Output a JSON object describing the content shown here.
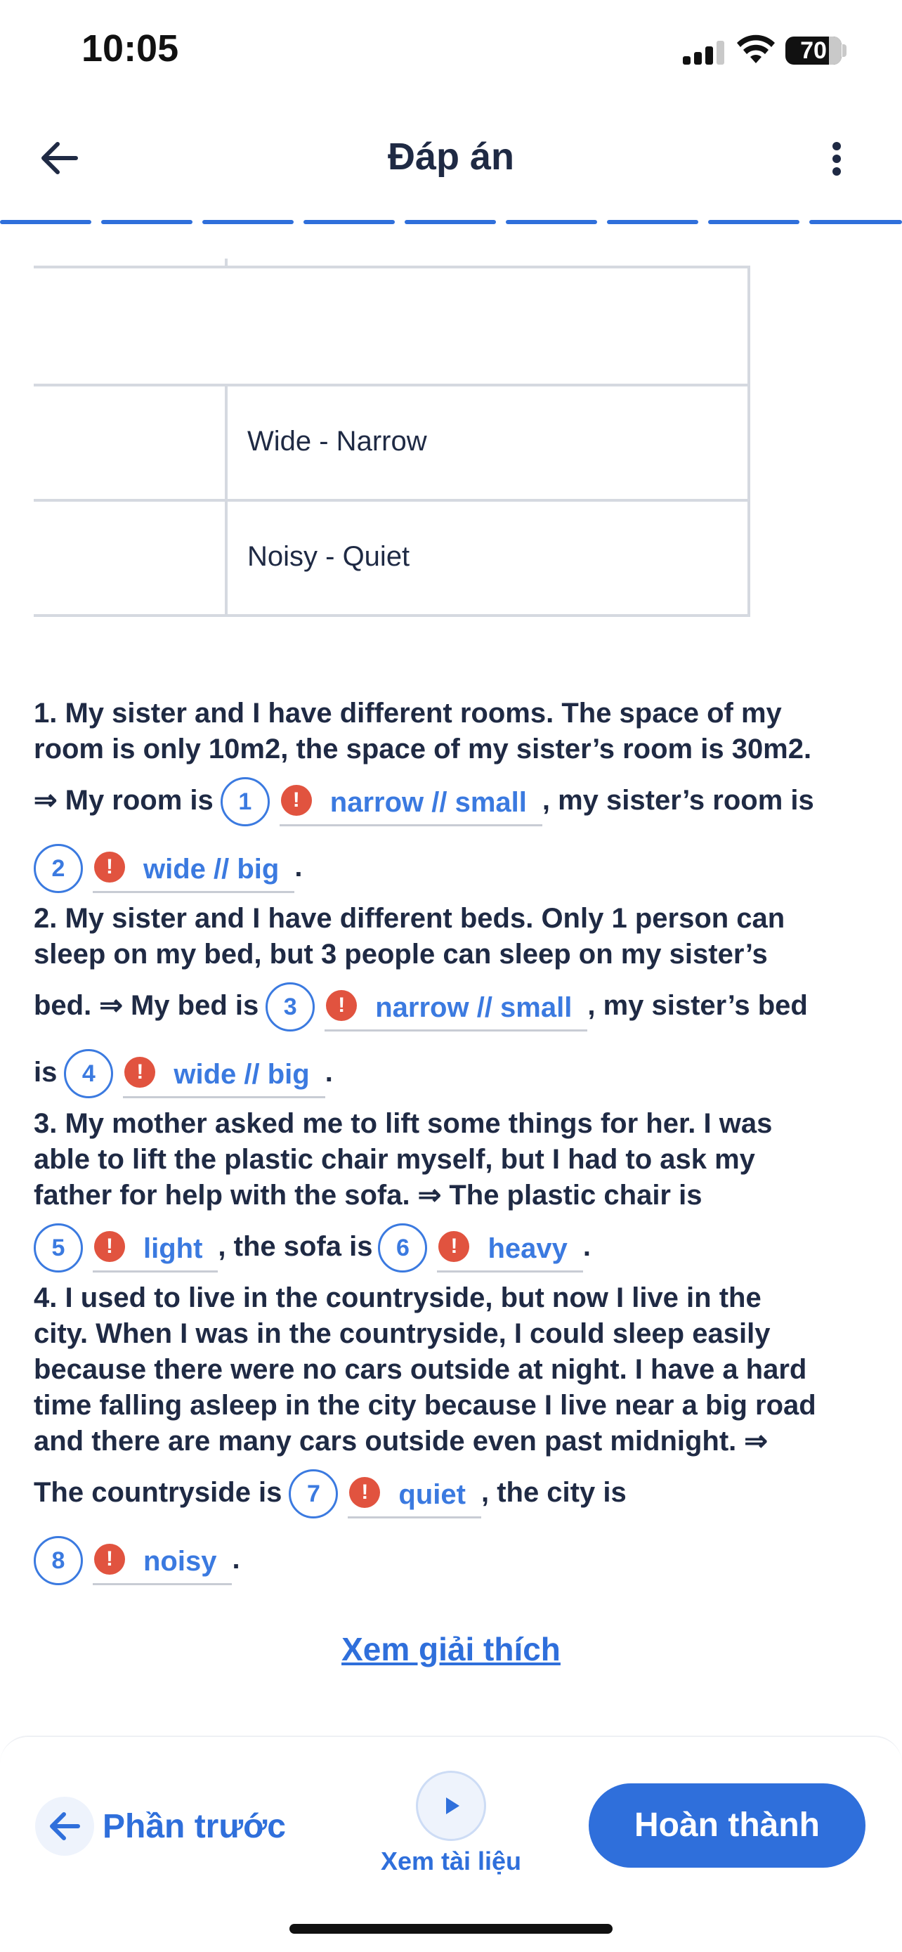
{
  "status_bar": {
    "time": "10:05",
    "battery": "70"
  },
  "header": {
    "title": "Đáp án"
  },
  "table": {
    "rows": [
      "",
      "Wide - Narrow",
      "Noisy - Quiet"
    ]
  },
  "questions": [
    {
      "lines": [
        "1. My sister and I have different rooms. The space of my",
        "room is only 10m2, the space of my sister’s room is 30m2."
      ],
      "answer_lines": [
        {
          "pre": "⇒ My room is",
          "items": [
            {
              "num": "1",
              "answer": "narrow // small",
              "post": ", my sister’s room is"
            }
          ]
        },
        {
          "pre": "",
          "items": [
            {
              "num": "2",
              "answer": "wide // big",
              "post": "."
            }
          ]
        }
      ]
    },
    {
      "lines": [
        "2. My sister and I have different beds. Only 1 person can",
        "sleep on my bed, but 3 people can sleep on my sister’s"
      ],
      "answer_lines": [
        {
          "pre": "bed. ⇒ My bed is",
          "items": [
            {
              "num": "3",
              "answer": "narrow // small",
              "post": ", my sister’s bed"
            }
          ]
        },
        {
          "pre": "is",
          "items": [
            {
              "num": "4",
              "answer": "wide // big",
              "post": "."
            }
          ]
        }
      ]
    },
    {
      "lines": [
        "3. My mother asked me to lift some things for her. I was",
        "able to lift the plastic chair myself, but I had to ask my",
        "father for help with the sofa. ⇒ The plastic chair is"
      ],
      "answer_lines": [
        {
          "pre": "",
          "items": [
            {
              "num": "5",
              "answer": "light",
              "post": ", the sofa is"
            },
            {
              "num": "6",
              "answer": "heavy",
              "post": "."
            }
          ]
        }
      ]
    },
    {
      "lines": [
        "4. I used to live in the countryside, but now I live in the",
        "city. When I was in the countryside, I could sleep easily",
        "because there were no cars outside at night. I have a hard",
        "time falling asleep in the city because I live near a big road",
        "and there are many cars outside even past midnight. ⇒"
      ],
      "answer_lines": [
        {
          "pre": "The countryside is",
          "items": [
            {
              "num": "7",
              "answer": "quiet",
              "post": ", the city is"
            }
          ]
        },
        {
          "pre": "",
          "items": [
            {
              "num": "8",
              "answer": "noisy",
              "post": "."
            }
          ]
        }
      ]
    }
  ],
  "alert_glyph": "!",
  "explain_link": "Xem giải thích",
  "bottom": {
    "prev_label": "Phần trước",
    "doc_label": "Xem tài liệu",
    "done_label": "Hoàn thành"
  },
  "colors": {
    "accent": "#2f6fdb",
    "answer": "#3b7ae0",
    "alert": "#e1533f",
    "text": "#1f2a44"
  }
}
